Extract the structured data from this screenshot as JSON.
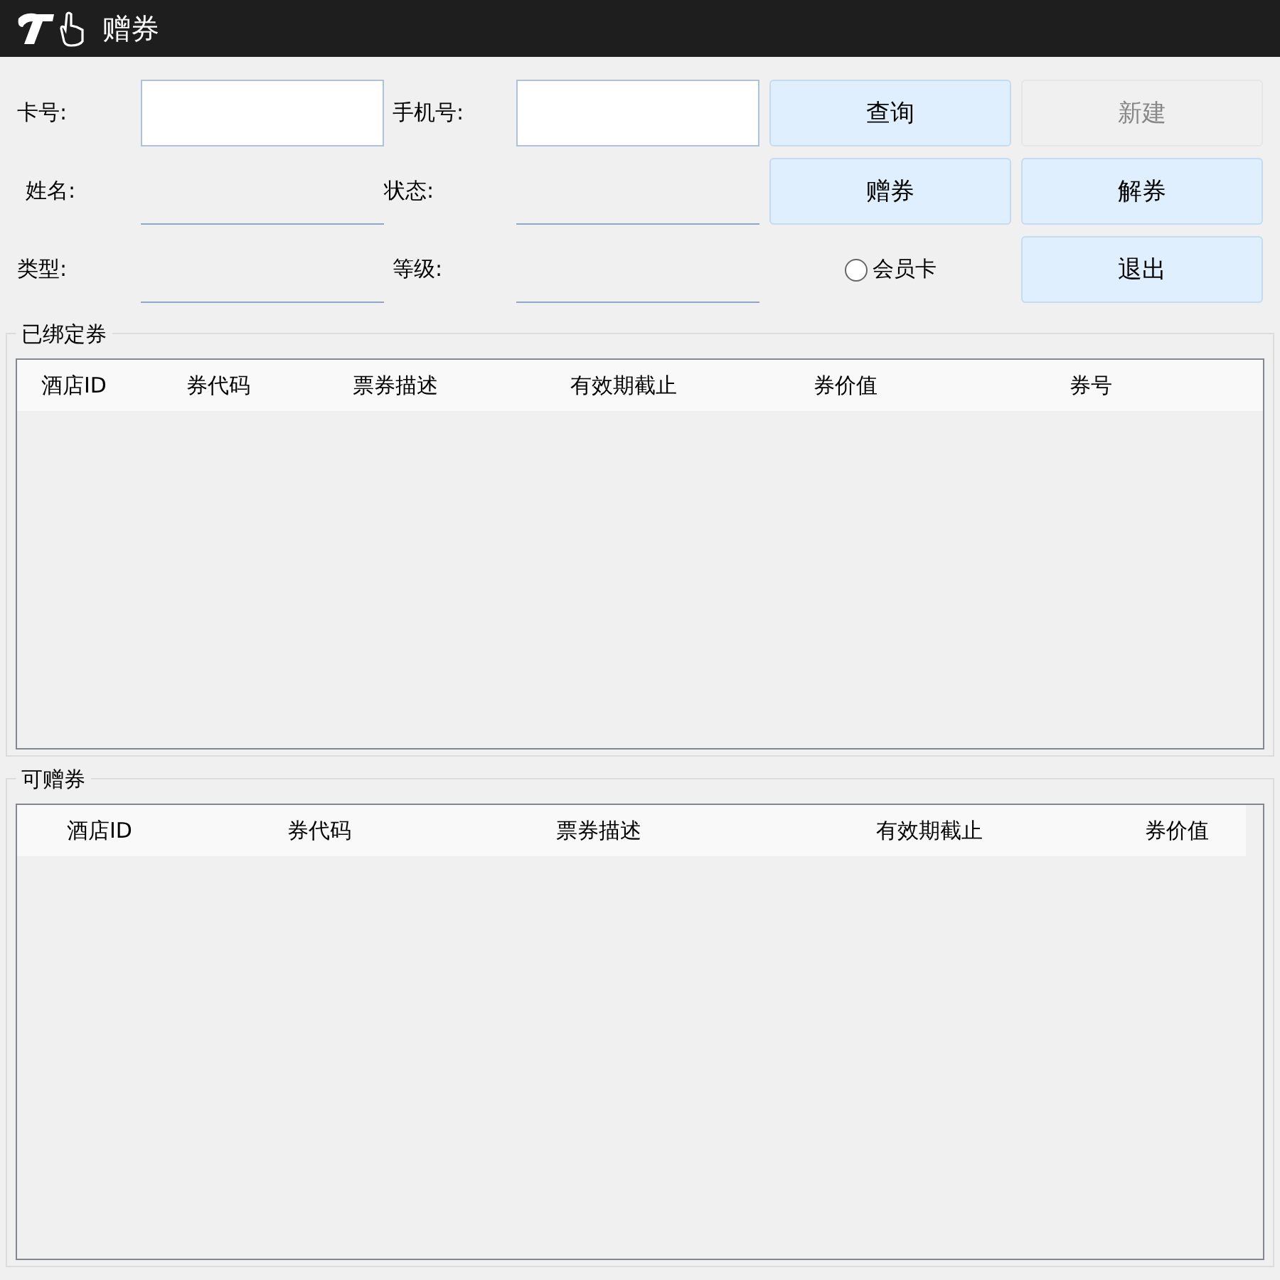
{
  "window": {
    "title": "赠券"
  },
  "form": {
    "fields": [
      {
        "label": "卡号:",
        "kind": "box"
      },
      {
        "label": "手机号:",
        "kind": "box"
      },
      {
        "label": "姓名:",
        "kind": "line"
      },
      {
        "label": "状态:",
        "kind": "line"
      },
      {
        "label": "类型:",
        "kind": "line"
      },
      {
        "label": "等级:",
        "kind": "line"
      }
    ],
    "buttons": [
      {
        "label": "查询",
        "disabled": false
      },
      {
        "label": "新建",
        "disabled": true
      },
      {
        "label": "赠券",
        "disabled": false
      },
      {
        "label": "解券",
        "disabled": false
      },
      {
        "label": "退出",
        "disabled": false
      }
    ],
    "radio": {
      "label": "会员卡",
      "selected": false
    }
  },
  "groups": [
    {
      "title": "已绑定券",
      "columns": [
        "酒店ID",
        "券代码",
        "票券描述",
        "有效期截止",
        "券价值",
        "券号"
      ]
    },
    {
      "title": "可赠券",
      "columns": [
        "酒店ID",
        "券代码",
        "票券描述",
        "有效期截止",
        "券价值"
      ]
    }
  ]
}
